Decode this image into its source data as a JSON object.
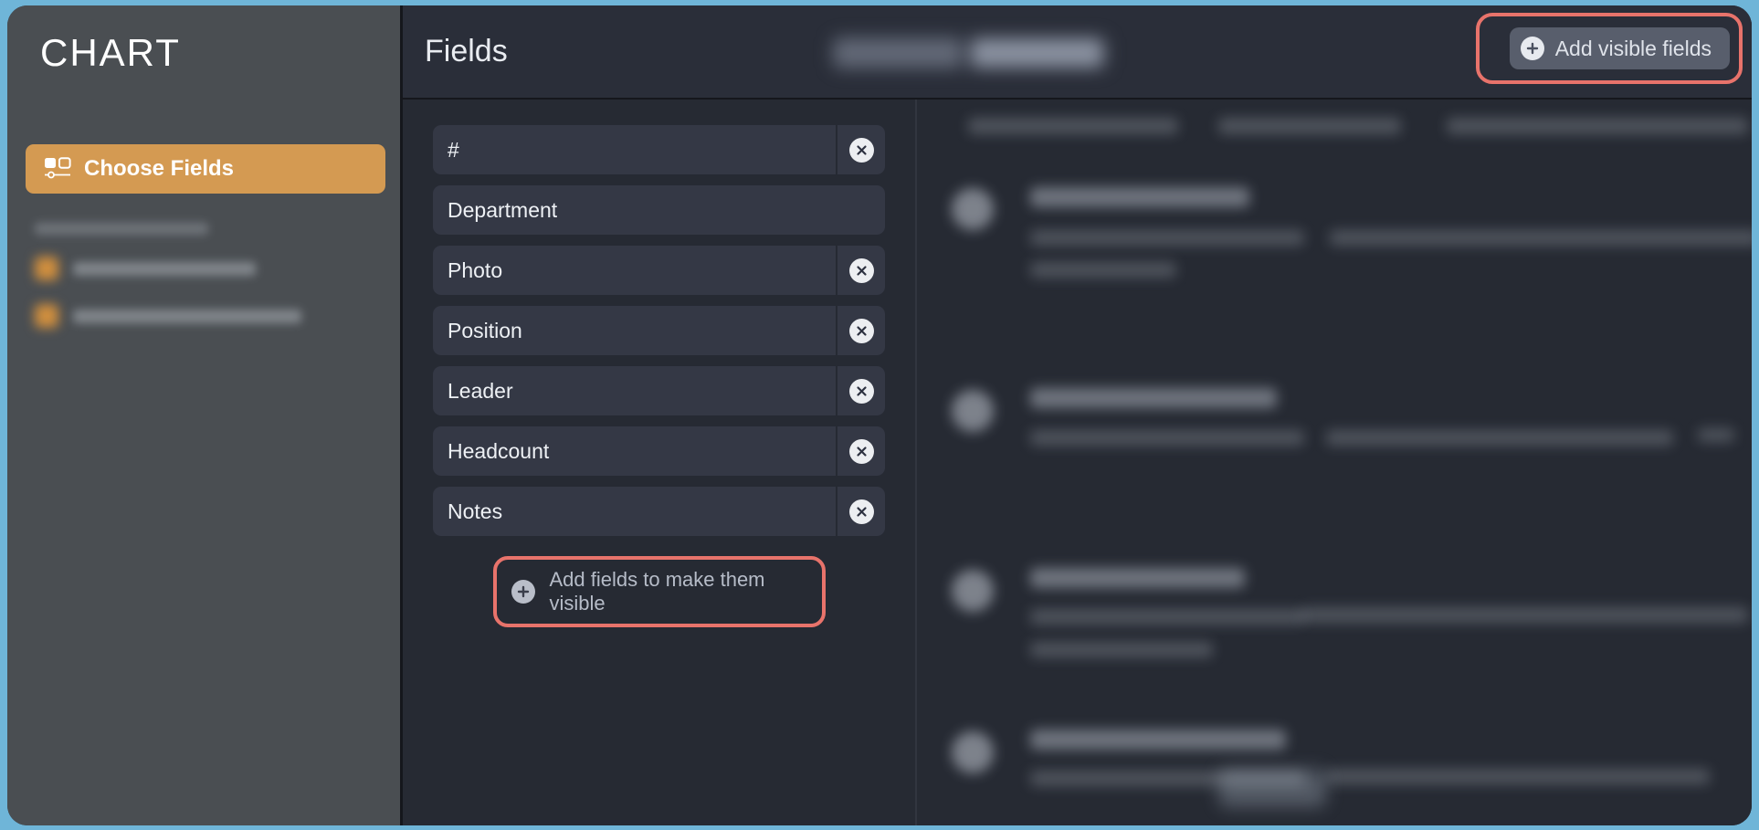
{
  "window": {
    "accent_border_color": "#6fb5d8",
    "highlight_ring_color": "#e8736b",
    "brand_accent_color": "#d49a52"
  },
  "sidebar": {
    "app_title": "CHART",
    "choose_fields": {
      "label": "Choose Fields",
      "icon": "fields-layout-icon",
      "active": true
    },
    "blurred_items_count": 2
  },
  "header": {
    "title": "Fields",
    "segmented_control_blurred": true,
    "add_visible_fields": {
      "label": "Add visible fields",
      "icon": "plus-circle-icon",
      "highlighted": true
    }
  },
  "fields_panel": {
    "rows": [
      {
        "name": "#",
        "removable": true
      },
      {
        "name": "Department",
        "removable": false
      },
      {
        "name": "Photo",
        "removable": true
      },
      {
        "name": "Position",
        "removable": true
      },
      {
        "name": "Leader",
        "removable": true
      },
      {
        "name": "Headcount",
        "removable": true
      },
      {
        "name": "Notes",
        "removable": true
      }
    ],
    "add_fields": {
      "label": "Add fields to make them visible",
      "icon": "plus-circle-icon",
      "highlighted": true
    }
  },
  "preview_panel": {
    "blurred": true,
    "list_items": 4,
    "footer_button_blurred": true
  }
}
